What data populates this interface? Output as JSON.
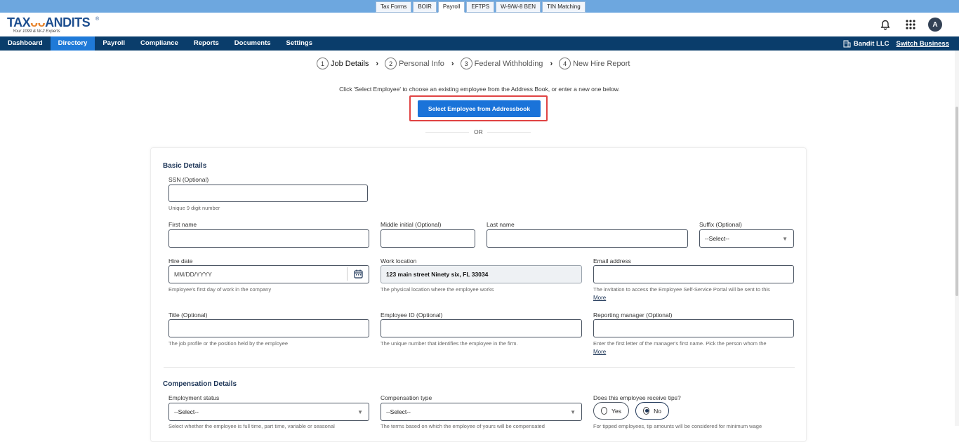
{
  "product_tabs": [
    {
      "label": "Tax Forms"
    },
    {
      "label": "BOIR"
    },
    {
      "label": "Payroll"
    },
    {
      "label": "EFTPS"
    },
    {
      "label": "W-9/W-8 BEN"
    },
    {
      "label": "TIN Matching"
    }
  ],
  "active_product_tab": "Payroll",
  "logo": {
    "brand": "TAXBANDITS",
    "tagline": "Your 1099 & W-2 Experts",
    "reg": "®"
  },
  "header": {
    "avatar_initial": "A"
  },
  "nav": {
    "items": [
      {
        "label": "Dashboard"
      },
      {
        "label": "Directory"
      },
      {
        "label": "Payroll"
      },
      {
        "label": "Compliance"
      },
      {
        "label": "Reports"
      },
      {
        "label": "Documents"
      },
      {
        "label": "Settings"
      }
    ],
    "active": "Directory",
    "business_name": "Bandit LLC",
    "switch_label": "Switch Business"
  },
  "steps": [
    {
      "num": "1",
      "label": "Job Details"
    },
    {
      "num": "2",
      "label": "Personal Info"
    },
    {
      "num": "3",
      "label": "Federal Withholding"
    },
    {
      "num": "4",
      "label": "New Hire Report"
    }
  ],
  "hint": "Click 'Select Employee' to choose an existing employee from the Address Book, or enter a new one below.",
  "select_button": "Select Employee from Addressbook",
  "or_text": "OR",
  "basic": {
    "title": "Basic Details",
    "ssn_label": "SSN (Optional)",
    "ssn_help": "Unique 9 digit number",
    "first_name_label": "First name",
    "middle_label": "Middle initial (Optional)",
    "last_name_label": "Last name",
    "suffix_label": "Suffix (Optional)",
    "suffix_value": "--Select--",
    "hire_date_label": "Hire date",
    "hire_date_placeholder": "MM/DD/YYYY",
    "hire_date_help": "Employee's first day of work in the company",
    "work_location_label": "Work location",
    "work_location_value": "123 main street Ninety six, FL 33034",
    "work_location_help": "The physical location where the employee works",
    "email_label": "Email address",
    "email_help": "The invitation to access the Employee Self-Service Portal will be sent to this",
    "email_more": "More",
    "title_label": "Title (Optional)",
    "title_help": "The job profile or the position held by the employee",
    "employee_id_label": "Employee ID (Optional)",
    "employee_id_help": "The unique number that identifies the employee in the firm.",
    "manager_label": "Reporting manager (Optional)",
    "manager_help": "Enter the first letter of the manager's first name. Pick the person whom the",
    "manager_more": "More"
  },
  "comp": {
    "title": "Compensation Details",
    "status_label": "Employment status",
    "status_value": "--Select--",
    "status_help": "Select whether the employee is full time, part time, variable or seasonal",
    "type_label": "Compensation type",
    "type_value": "--Select--",
    "type_help": "The terms based on which the employee of yours will be compensated",
    "tips_label": "Does this employee receive tips?",
    "tips_yes": "Yes",
    "tips_no": "No",
    "tips_selected": "No",
    "tips_help": "For tipped employees, tip amounts will be considered for minimum wage"
  }
}
